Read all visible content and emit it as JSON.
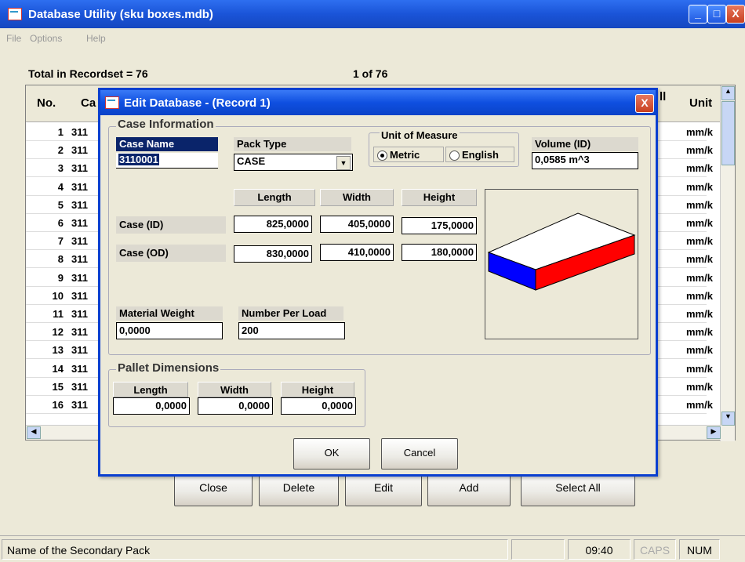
{
  "window": {
    "title": "Database Utility (sku boxes.mdb)",
    "min": "_",
    "max": "□",
    "close": "X"
  },
  "menu": {
    "file": "File",
    "options": "Options",
    "help": "Help"
  },
  "header": {
    "total": "Total in Recordset = 76",
    "position": "1 of 76"
  },
  "grid": {
    "col_no": "No.",
    "col_case": "Ca",
    "col_all": "ll",
    "col_unit": "Unit",
    "rows": [
      {
        "no": "1",
        "case": "311",
        "unit": "mm/k"
      },
      {
        "no": "2",
        "case": "311",
        "unit": "mm/k"
      },
      {
        "no": "3",
        "case": "311",
        "unit": "mm/k"
      },
      {
        "no": "4",
        "case": "311",
        "unit": "mm/k"
      },
      {
        "no": "5",
        "case": "311",
        "unit": "mm/k"
      },
      {
        "no": "6",
        "case": "311",
        "unit": "mm/k"
      },
      {
        "no": "7",
        "case": "311",
        "unit": "mm/k"
      },
      {
        "no": "8",
        "case": "311",
        "unit": "mm/k"
      },
      {
        "no": "9",
        "case": "311",
        "unit": "mm/k"
      },
      {
        "no": "10",
        "case": "311",
        "unit": "mm/k"
      },
      {
        "no": "11",
        "case": "311",
        "unit": "mm/k"
      },
      {
        "no": "12",
        "case": "311",
        "unit": "mm/k"
      },
      {
        "no": "13",
        "case": "311",
        "unit": "mm/k"
      },
      {
        "no": "14",
        "case": "311",
        "unit": "mm/k"
      },
      {
        "no": "15",
        "case": "311",
        "unit": "mm/k"
      },
      {
        "no": "16",
        "case": "311",
        "unit": "mm/k"
      }
    ]
  },
  "buttons": {
    "close": "Close",
    "delete": "Delete",
    "edit": "Edit",
    "add": "Add",
    "select_all": "Select All"
  },
  "status": {
    "message": "Name of the Secondary Pack",
    "time": "09:40",
    "caps": "CAPS",
    "num": "NUM"
  },
  "dialog": {
    "title": "Edit Database - (Record 1)",
    "close": "X",
    "case_info": {
      "group_label": "Case Information",
      "case_name_label": "Case Name",
      "case_name_value": "3110001",
      "pack_type_label": "Pack Type",
      "pack_type_value": "CASE",
      "uom_label": "Unit of Measure",
      "uom_metric": "Metric",
      "uom_english": "English",
      "volume_label": "Volume (ID)",
      "volume_value": "0,0585 m^3",
      "length_hdr": "Length",
      "width_hdr": "Width",
      "height_hdr": "Height",
      "case_id_label": "Case (ID)",
      "case_id": {
        "length": "825,0000",
        "width": "405,0000",
        "height": "175,0000"
      },
      "case_od_label": "Case (OD)",
      "case_od": {
        "length": "830,0000",
        "width": "410,0000",
        "height": "180,0000"
      },
      "material_weight_label": "Material Weight",
      "material_weight_value": "0,0000",
      "number_per_load_label": "Number Per Load",
      "number_per_load_value": "200"
    },
    "pallet": {
      "group_label": "Pallet Dimensions",
      "length_label": "Length",
      "length_value": "0,0000",
      "width_label": "Width",
      "width_value": "0,0000",
      "height_label": "Height",
      "height_value": "0,0000"
    },
    "ok": "OK",
    "cancel": "Cancel"
  },
  "colors": {
    "box_top": "#ffffff",
    "box_left": "#0000ff",
    "box_right": "#ff0000",
    "title_blue": "#0a43c8"
  },
  "icons": {
    "app": "app-icon",
    "dropdown": "chevron-down-icon",
    "scroll_up": "arrow-up-icon",
    "scroll_down": "arrow-down-icon",
    "scroll_left": "arrow-left-icon",
    "scroll_right": "arrow-right-icon"
  }
}
